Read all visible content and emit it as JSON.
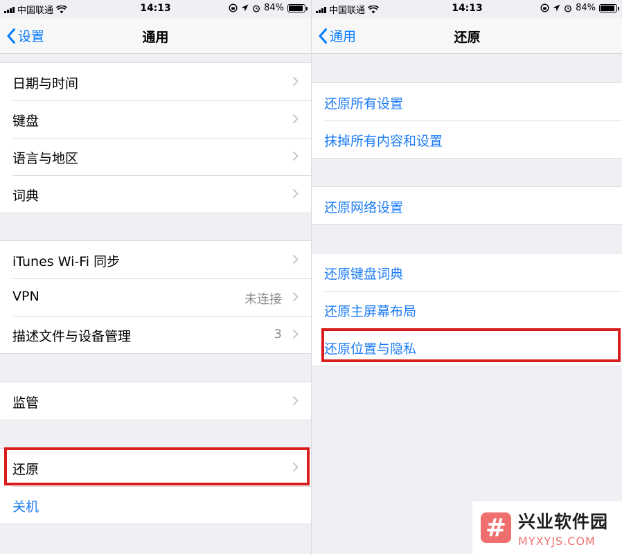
{
  "left": {
    "status": {
      "carrier": "中国联通",
      "time": "14:13",
      "battery": "84%",
      "battery_level": 0.84
    },
    "nav": {
      "back_label": "设置",
      "title": "通用"
    },
    "groups": [
      [
        {
          "label": "日期与时间"
        },
        {
          "label": "键盘"
        },
        {
          "label": "语言与地区"
        },
        {
          "label": "词典"
        }
      ],
      [
        {
          "label": "iTunes Wi-Fi 同步"
        },
        {
          "label": "VPN",
          "value": "未连接"
        },
        {
          "label": "描述文件与设备管理",
          "value": "3"
        }
      ],
      [
        {
          "label": "监管"
        }
      ],
      [
        {
          "label": "还原"
        },
        {
          "label": "关机"
        }
      ]
    ]
  },
  "right": {
    "status": {
      "carrier": "中国联通",
      "time": "14:13",
      "battery": "84%",
      "battery_level": 0.84
    },
    "nav": {
      "back_label": "通用",
      "title": "还原"
    },
    "groups": [
      [
        {
          "label": "还原所有设置"
        },
        {
          "label": "抹掉所有内容和设置"
        }
      ],
      [
        {
          "label": "还原网络设置"
        }
      ],
      [
        {
          "label": "还原键盘词典"
        },
        {
          "label": "还原主屏幕布局"
        },
        {
          "label": "还原位置与隐私"
        }
      ]
    ]
  },
  "watermark": {
    "logo_glyph": "#",
    "name": "兴业软件园",
    "domain": "MYXYJS.COM"
  },
  "colors": {
    "link_blue": "#1e7cf5",
    "highlight_red": "#d81d1d",
    "background": "#efeff4"
  }
}
